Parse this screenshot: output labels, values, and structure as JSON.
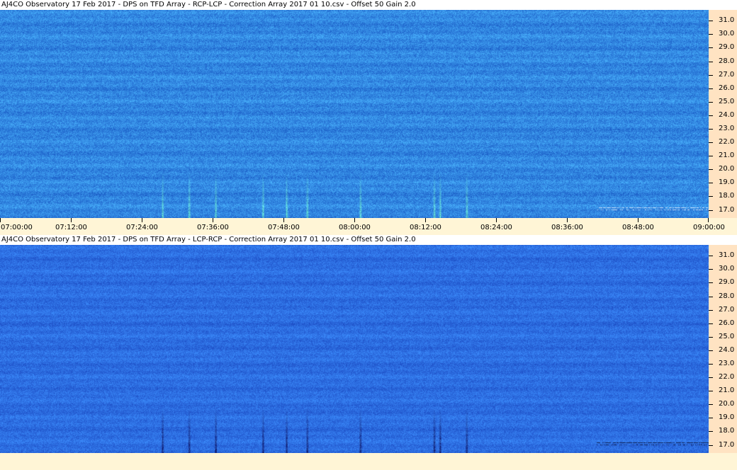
{
  "panels": [
    {
      "title": "AJ4CO Observatory 17 Feb 2017  -  DPS on TFD Array  -  RCP-LCP  -  Correction Array 2017 01 10.csv  -  Offset 50  Gain 2.0",
      "mode": "positive",
      "base_color": "#2a66d8",
      "burst_color": "#6ee8a0"
    },
    {
      "title": "AJ4CO Observatory 17 Feb 2017  -  DPS on TFD Array  -  LCP-RCP  -  Correction Array 2017 01 10.csv  -  Offset 50  Gain 2.0",
      "mode": "negative",
      "base_color": "#2a5ee0",
      "burst_color": "#0a1040"
    }
  ],
  "chart_data": {
    "type": "heatmap",
    "xlabel": "",
    "ylabel": "",
    "x_ticks": [
      "07:00:00",
      "07:12:00",
      "07:24:00",
      "07:36:00",
      "07:48:00",
      "08:00:00",
      "08:12:00",
      "08:24:00",
      "08:36:00",
      "08:48:00",
      "09:00:00"
    ],
    "y_ticks": [
      "31.0",
      "30.0",
      "29.0",
      "28.0",
      "27.0",
      "26.0",
      "25.0",
      "24.0",
      "23.0",
      "22.0",
      "21.0",
      "20.0",
      "19.0",
      "18.0",
      "17.0"
    ],
    "ylim": [
      16.4,
      31.8
    ],
    "xlim_minutes": [
      0,
      120
    ],
    "bursts_minutes": [
      27.5,
      32.0,
      36.5,
      44.5,
      48.5,
      52.0,
      61.0,
      73.5,
      74.5,
      79.0
    ]
  }
}
